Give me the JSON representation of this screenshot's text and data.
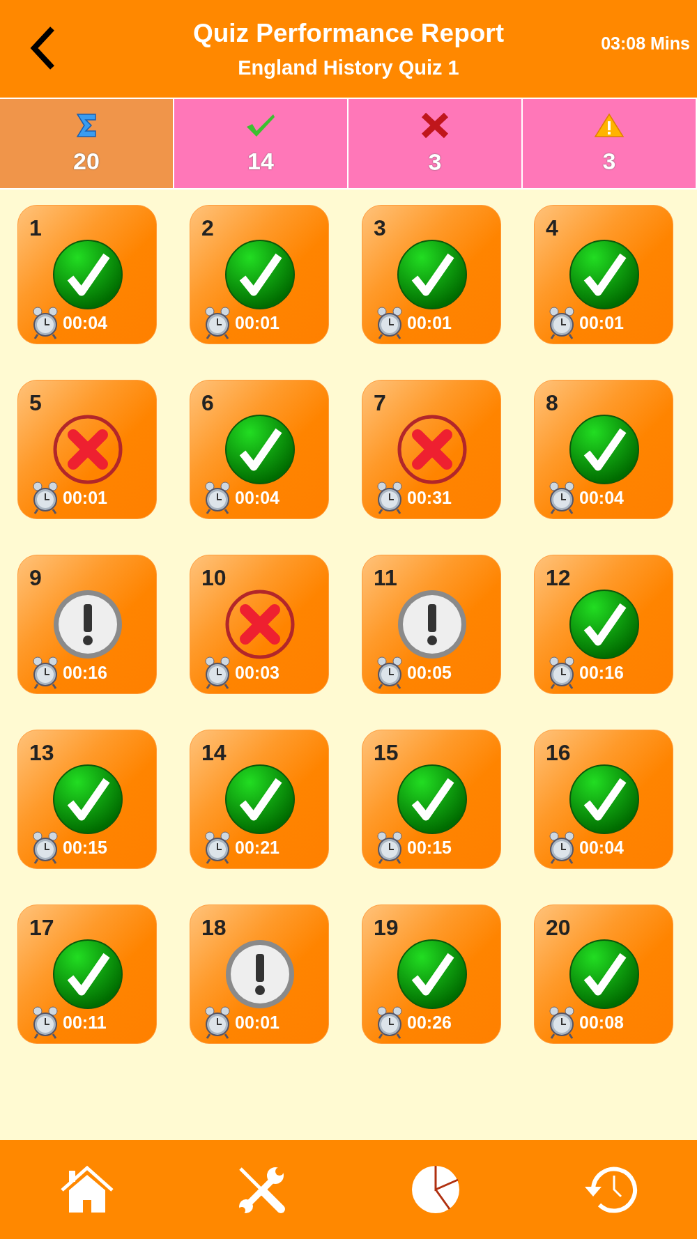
{
  "header": {
    "title": "Quiz Performance Report",
    "subtitle": "England History Quiz 1",
    "time": "03:08 Mins"
  },
  "stats": [
    {
      "kind": "total",
      "value": "20",
      "selected": true
    },
    {
      "kind": "correct",
      "value": "14",
      "selected": false
    },
    {
      "kind": "wrong",
      "value": "3",
      "selected": false
    },
    {
      "kind": "skipped",
      "value": "3",
      "selected": false
    }
  ],
  "questions": [
    {
      "number": "1",
      "kind": "correct",
      "time": "00:04"
    },
    {
      "number": "2",
      "kind": "correct",
      "time": "00:01"
    },
    {
      "number": "3",
      "kind": "correct",
      "time": "00:01"
    },
    {
      "number": "4",
      "kind": "correct",
      "time": "00:01"
    },
    {
      "number": "5",
      "kind": "wrong",
      "time": "00:01"
    },
    {
      "number": "6",
      "kind": "correct",
      "time": "00:04"
    },
    {
      "number": "7",
      "kind": "wrong",
      "time": "00:31"
    },
    {
      "number": "8",
      "kind": "correct",
      "time": "00:04"
    },
    {
      "number": "9",
      "kind": "skipped",
      "time": "00:16"
    },
    {
      "number": "10",
      "kind": "wrong",
      "time": "00:03"
    },
    {
      "number": "11",
      "kind": "skipped",
      "time": "00:05"
    },
    {
      "number": "12",
      "kind": "correct",
      "time": "00:16"
    },
    {
      "number": "13",
      "kind": "correct",
      "time": "00:15"
    },
    {
      "number": "14",
      "kind": "correct",
      "time": "00:21"
    },
    {
      "number": "15",
      "kind": "correct",
      "time": "00:15"
    },
    {
      "number": "16",
      "kind": "correct",
      "time": "00:04"
    },
    {
      "number": "17",
      "kind": "correct",
      "time": "00:11"
    },
    {
      "number": "18",
      "kind": "skipped",
      "time": "00:01"
    },
    {
      "number": "19",
      "kind": "correct",
      "time": "00:26"
    },
    {
      "number": "20",
      "kind": "correct",
      "time": "00:08"
    }
  ],
  "tab_bar": [
    {
      "kind": "home"
    },
    {
      "kind": "tools"
    },
    {
      "kind": "chart"
    },
    {
      "kind": "history"
    }
  ]
}
